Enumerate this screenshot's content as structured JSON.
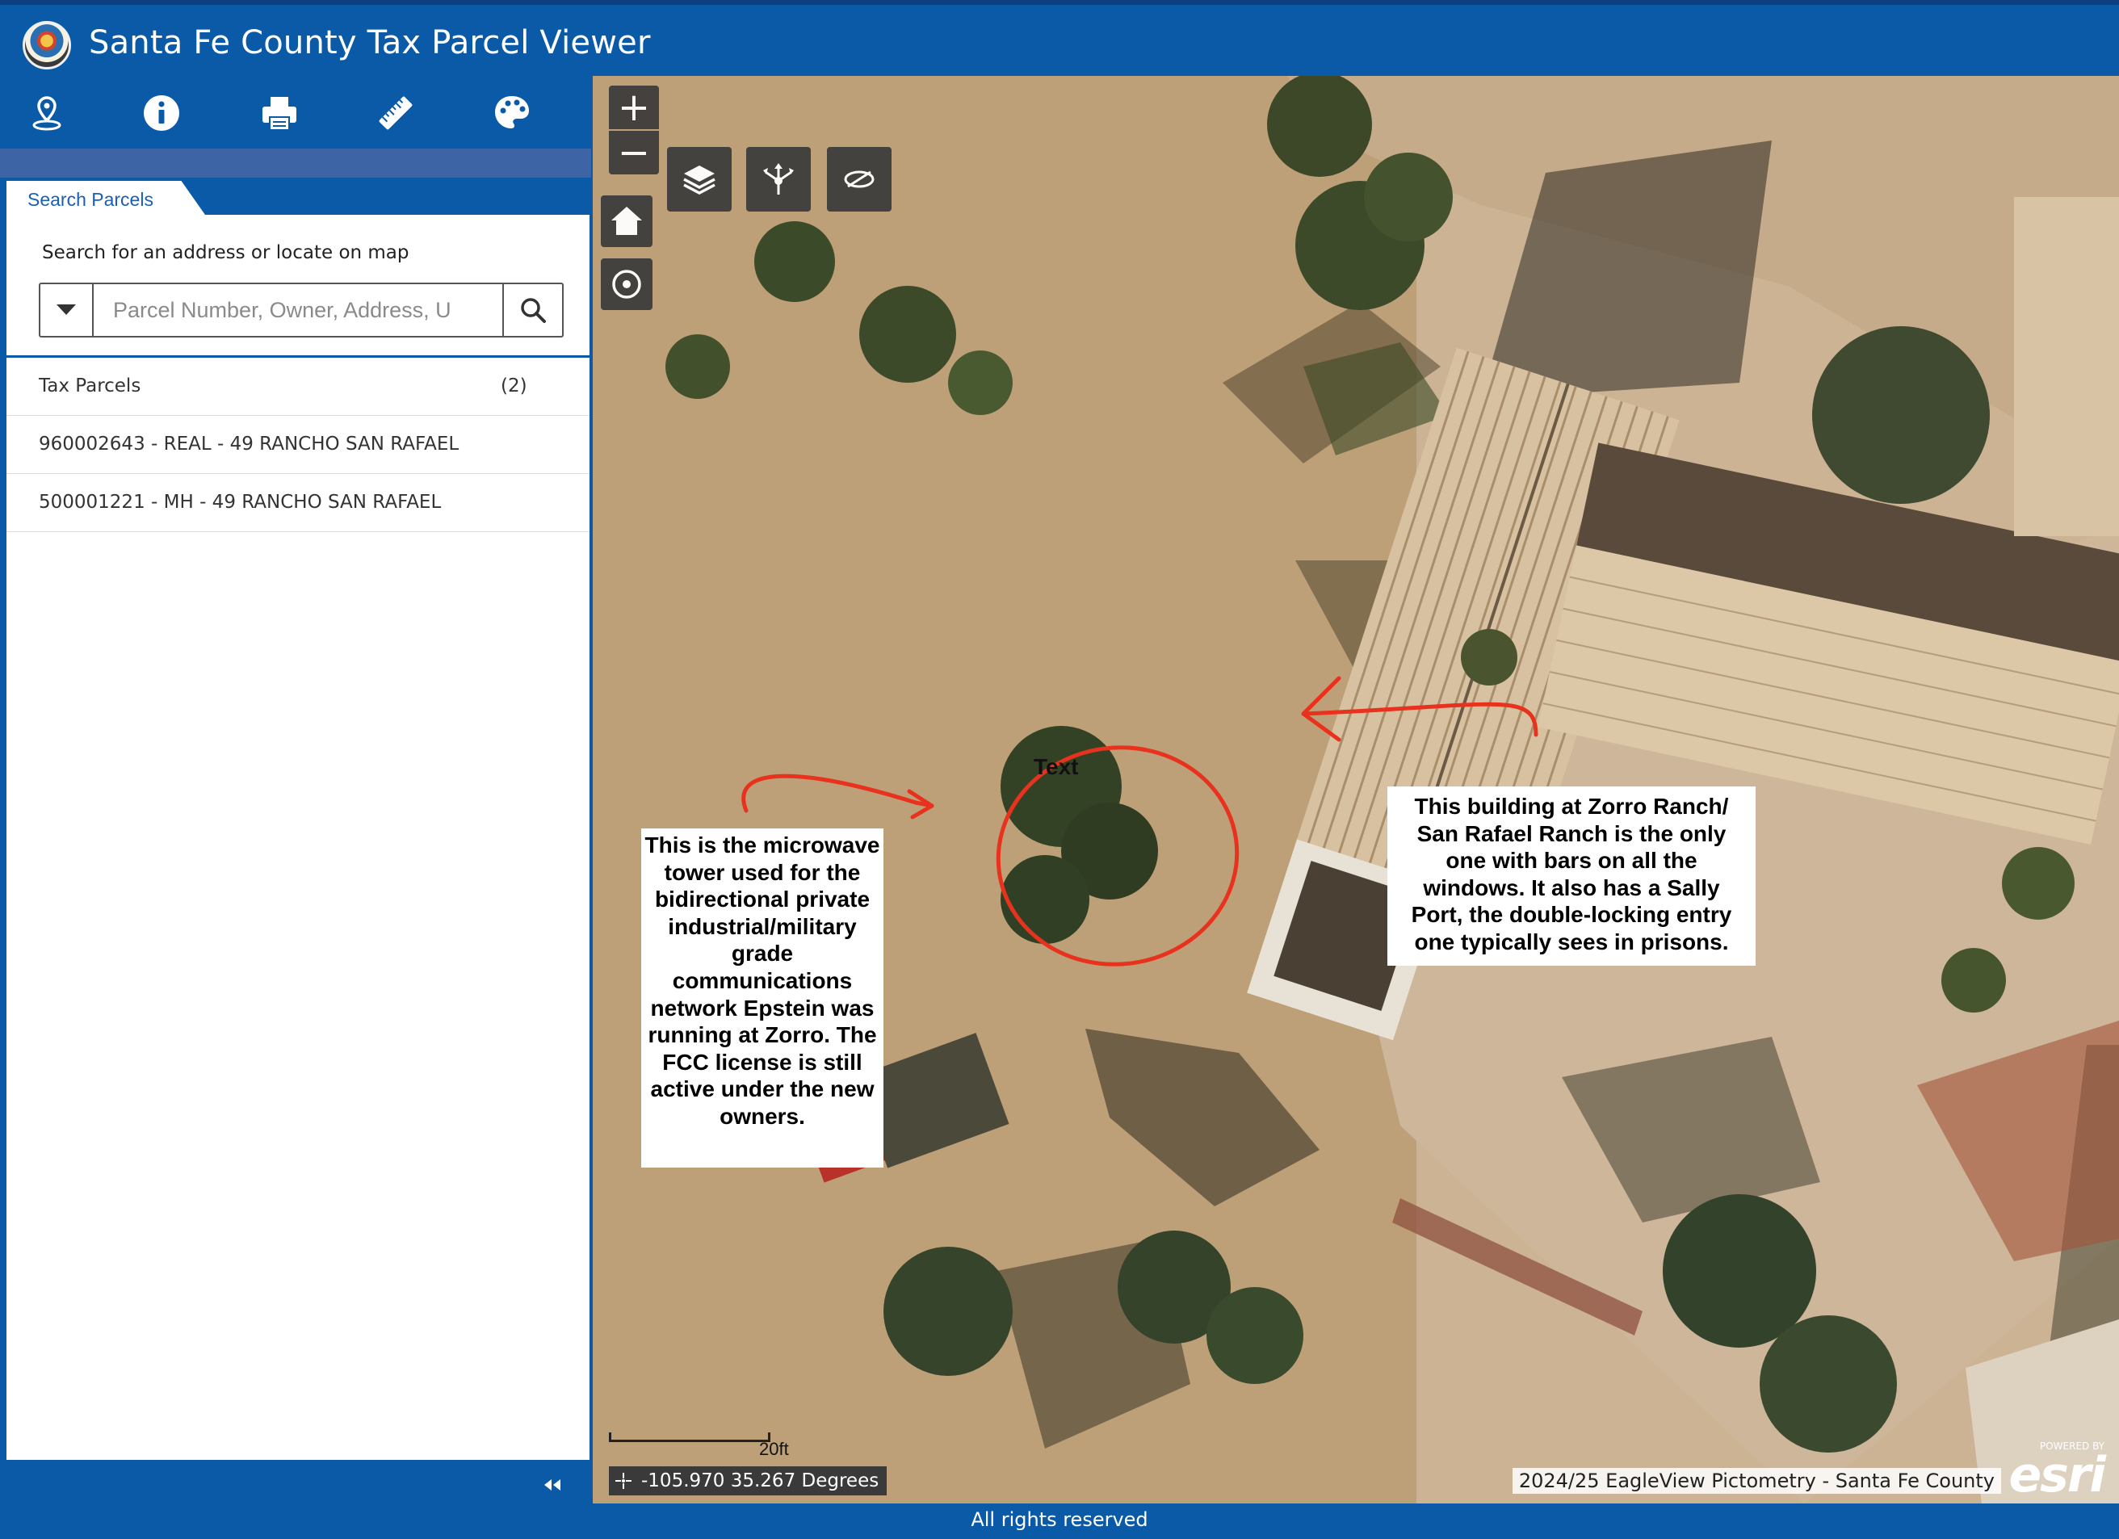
{
  "app": {
    "title": "Santa Fe County Tax Parcel Viewer"
  },
  "toolbar": {
    "tools": [
      {
        "icon": "location-pin-icon"
      },
      {
        "icon": "info-icon"
      },
      {
        "icon": "print-icon"
      },
      {
        "icon": "measure-ruler-icon"
      },
      {
        "icon": "basemap-palette-icon"
      }
    ]
  },
  "panel": {
    "tab_label": "Search Parcels",
    "search_hint": "Search for an address or locate on map",
    "search_placeholder": "Parcel Number, Owner, Address, U",
    "results_group_label": "Tax Parcels",
    "results_count": "(2)",
    "results": [
      {
        "label": "960002643 - REAL - 49 RANCHO SAN RAFAEL"
      },
      {
        "label": "500001221 - MH - 49 RANCHO SAN RAFAEL"
      }
    ]
  },
  "map": {
    "zoom_in_label": "+",
    "zoom_out_label": "−",
    "buttons": [
      "layers-icon",
      "share-icon",
      "hide-icon",
      "home-icon",
      "locate-icon"
    ],
    "callout_tower": "This is the microwave tower used for the bidirectional private industrial/military grade communications network Epstein was running at Zorro. The FCC license is still active under the new owners.",
    "callout_building": "This building at Zorro Ranch/ San Rafael Ranch is the only one with bars on all the windows. It also has a Sally Port, the double-locking entry one typically sees in prisons.",
    "text_label": "Text",
    "scale_label": "20ft",
    "coordinates": "-105.970 35.267 Degrees",
    "attribution": "2024/25 EagleView Pictometry - Santa Fe County",
    "esri_small": "POWERED BY",
    "esri_big": "esri"
  },
  "footer": {
    "text": "All rights reserved"
  },
  "colors": {
    "header": "#0a5aa8",
    "subbar": "#3d64a5",
    "annotation_red": "#e8321e"
  }
}
